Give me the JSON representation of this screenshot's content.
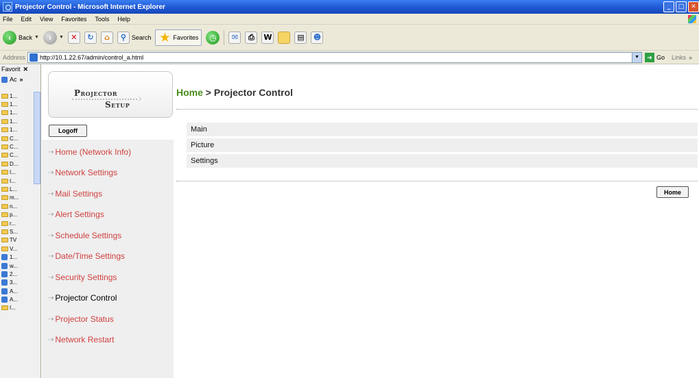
{
  "window": {
    "title": "Projector Control - Microsoft Internet Explorer"
  },
  "menubar": {
    "items": [
      "File",
      "Edit",
      "View",
      "Favorites",
      "Tools",
      "Help"
    ]
  },
  "toolbar": {
    "back_label": "Back",
    "search_label": "Search",
    "favorites_label": "Favorites"
  },
  "address": {
    "label": "Address",
    "url": "http://10.1.22.67/admin/control_a.html",
    "go_label": "Go",
    "links_label": "Links"
  },
  "favorites_pane": {
    "title": "Favorit",
    "add_label": "Ac",
    "items": [
      "1...",
      "1...",
      "1...",
      "1...",
      "1...",
      "C...",
      "C...",
      "C...",
      "D...",
      "I...",
      "I...",
      "L...",
      "m...",
      "n...",
      "p...",
      "r...",
      "S...",
      "TV",
      "V...",
      "1...",
      "w...",
      "2...",
      "3...",
      "A...",
      "A...",
      "I..."
    ]
  },
  "sidebar": {
    "logo_line1": "Projector",
    "logo_line2": "Setup",
    "logoff_label": "Logoff",
    "nav": [
      {
        "label": "Home (Network Info)"
      },
      {
        "label": "Network Settings"
      },
      {
        "label": "Mail Settings"
      },
      {
        "label": "Alert Settings"
      },
      {
        "label": "Schedule Settings"
      },
      {
        "label": "Date/Time Settings"
      },
      {
        "label": "Security Settings"
      },
      {
        "label": "Projector Control"
      },
      {
        "label": "Projector Status"
      },
      {
        "label": "Network Restart"
      }
    ]
  },
  "main": {
    "breadcrumb_home": "Home",
    "breadcrumb_sep": " > ",
    "breadcrumb_current": "Projector Control",
    "menu": [
      "Main",
      "Picture",
      "Settings"
    ],
    "home_button_label": "Home"
  },
  "colors": {
    "title_blue": "#1d55d0",
    "link_red": "#d04040",
    "breadcrumb_green": "#4a8c1c",
    "nav_bg": "#efefef"
  }
}
